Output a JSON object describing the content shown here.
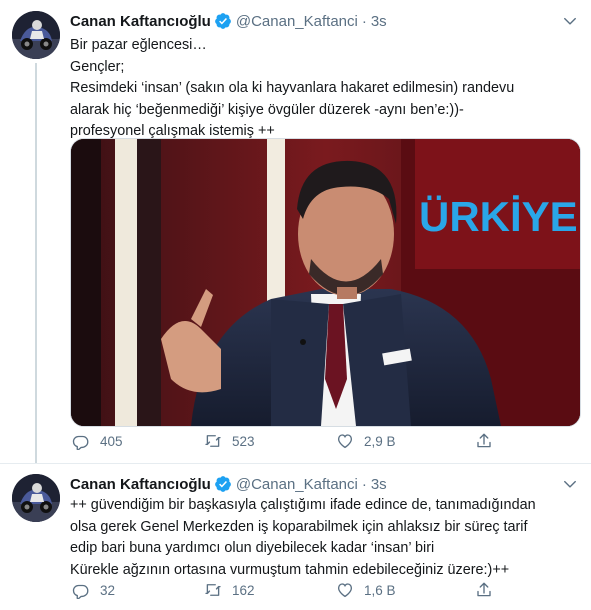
{
  "tweets": [
    {
      "author": {
        "name": "Canan Kaftancıoğlu",
        "handle": "@Canan_Kaftanci",
        "separator": "·",
        "time": "3s"
      },
      "lines": [
        "Bir pazar eğlencesi…",
        "Gençler;",
        "Resimdeki ‘insan’ (sakın ola ki hayvanlara hakaret edilmesin) randevu",
        "alarak hiç ‘beğenmediği’ kişiye övgüler düzerek -aynı ben’e:))-",
        "profesyonel çalışmak istemiş ++"
      ],
      "media": {
        "visible_text": "ÜRKİYE"
      },
      "stats": {
        "replies": "405",
        "retweets": "523",
        "likes": "2,9 B"
      }
    },
    {
      "author": {
        "name": "Canan Kaftancıoğlu",
        "handle": "@Canan_Kaftanci",
        "separator": "·",
        "time": "3s"
      },
      "lines": [
        "++ güvendiğim bir başkasıyla çalıştığımı ifade edince de, tanımadığından",
        "olsa gerek Genel Merkezden iş koparabilmek için  ahlaksız bir süreç tarif",
        "edip bari buna yardımcı olun diyebilecek kadar ‘insan’ biri",
        "Kürekle ağzının ortasına vurmuştum tahmin edebileceğiniz üzere:)++"
      ],
      "stats": {
        "replies": "32",
        "retweets": "162",
        "likes": "1,6 B"
      }
    }
  ],
  "colors": {
    "verified": "#1da1f2",
    "secondary_text": "#5b7083",
    "divider": "#e6ecf0"
  },
  "icons": [
    "verified-badge-icon",
    "chevron-down-icon",
    "reply-icon",
    "retweet-icon",
    "like-icon",
    "share-icon"
  ]
}
